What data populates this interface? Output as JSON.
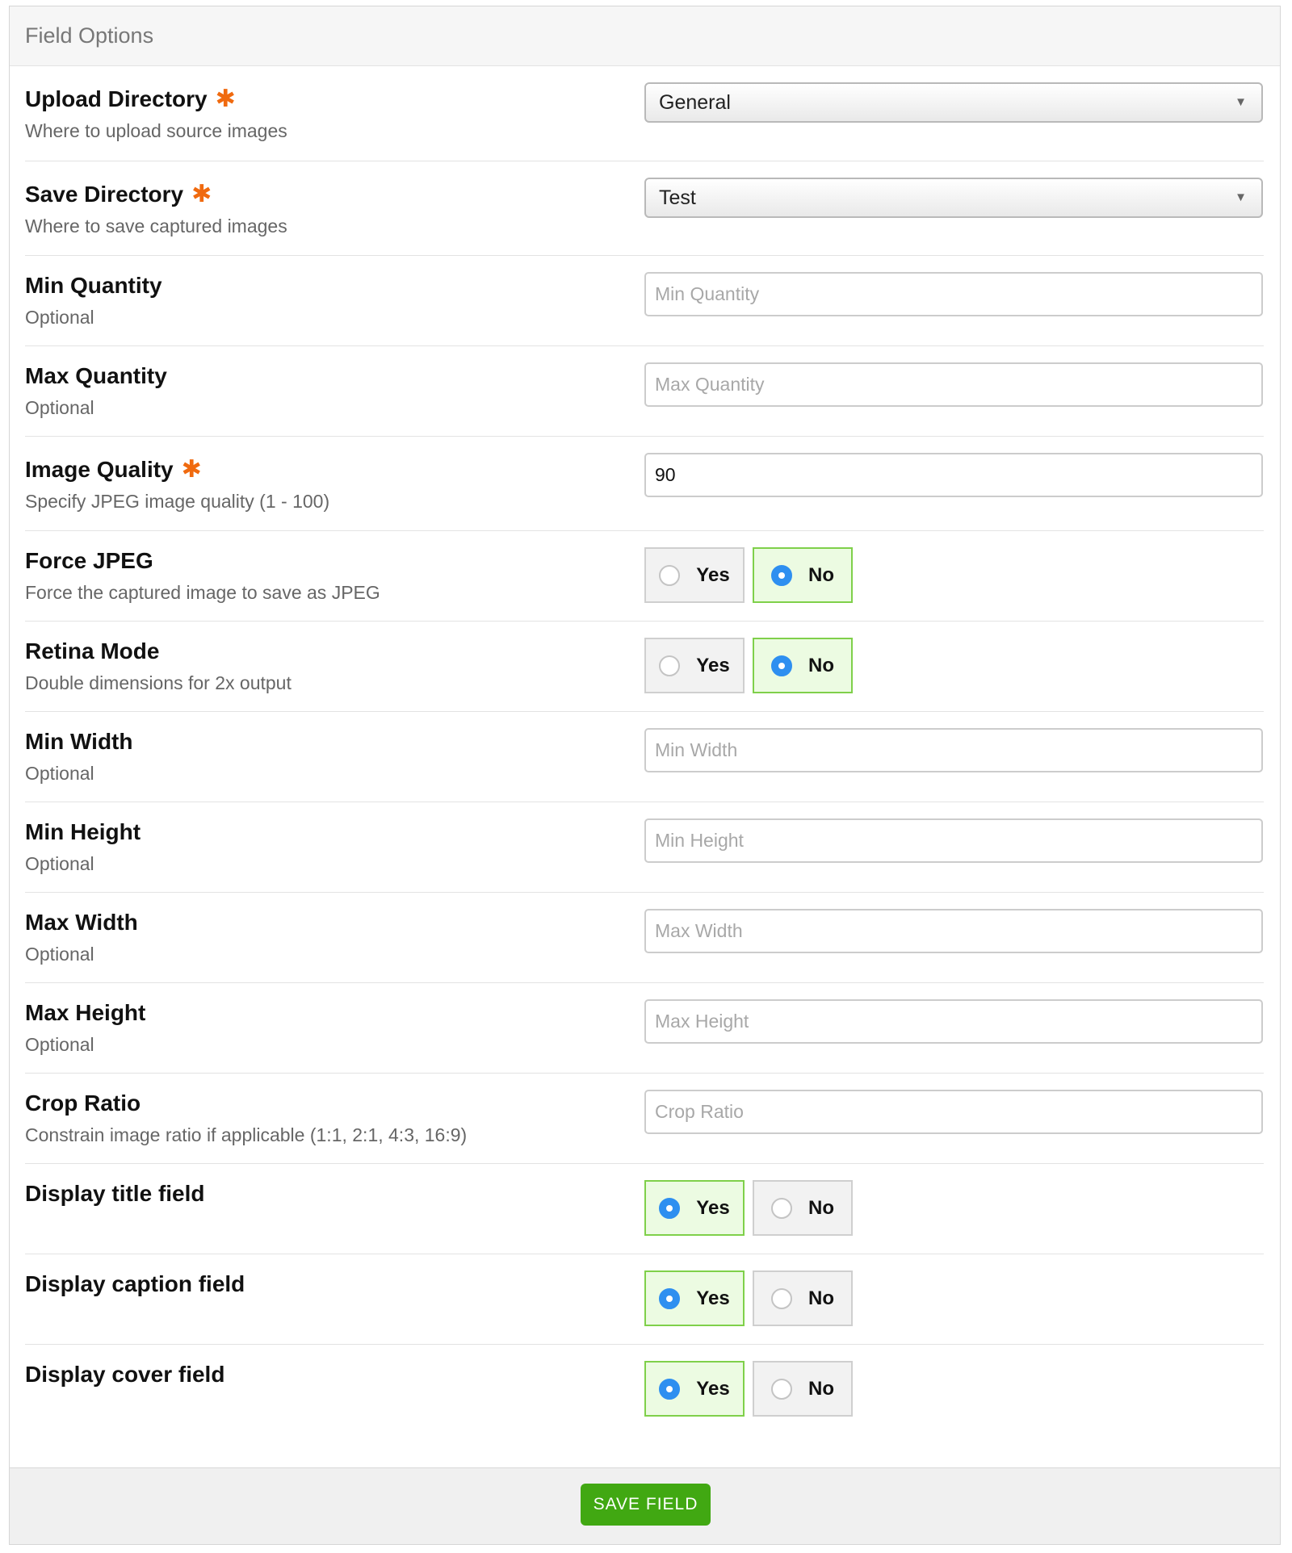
{
  "panel": {
    "title": "Field Options"
  },
  "colors": {
    "accent_green": "#41a812",
    "required_asterisk": "#f06a0f",
    "radio_selected": "#2e8ff0"
  },
  "fields": {
    "upload_directory": {
      "label": "Upload Directory",
      "required": "✱",
      "description": "Where to upload source images",
      "value": "General"
    },
    "save_directory": {
      "label": "Save Directory",
      "required": "✱",
      "description": "Where to save captured images",
      "value": "Test"
    },
    "min_quantity": {
      "label": "Min Quantity",
      "description": "Optional",
      "placeholder": "Min Quantity",
      "value": ""
    },
    "max_quantity": {
      "label": "Max Quantity",
      "description": "Optional",
      "placeholder": "Max Quantity",
      "value": ""
    },
    "image_quality": {
      "label": "Image Quality",
      "required": "✱",
      "description": "Specify JPEG image quality (1 - 100)",
      "value": "90"
    },
    "force_jpeg": {
      "label": "Force JPEG",
      "description": "Force the captured image to save as JPEG",
      "yes": "Yes",
      "no": "No",
      "selected": "no"
    },
    "retina_mode": {
      "label": "Retina Mode",
      "description": "Double dimensions for 2x output",
      "yes": "Yes",
      "no": "No",
      "selected": "no"
    },
    "min_width": {
      "label": "Min Width",
      "description": "Optional",
      "placeholder": "Min Width",
      "value": ""
    },
    "min_height": {
      "label": "Min Height",
      "description": "Optional",
      "placeholder": "Min Height",
      "value": ""
    },
    "max_width": {
      "label": "Max Width",
      "description": "Optional",
      "placeholder": "Max Width",
      "value": ""
    },
    "max_height": {
      "label": "Max Height",
      "description": "Optional",
      "placeholder": "Max Height",
      "value": ""
    },
    "crop_ratio": {
      "label": "Crop Ratio",
      "description": "Constrain image ratio if applicable (1:1, 2:1, 4:3, 16:9)",
      "placeholder": "Crop Ratio",
      "value": ""
    },
    "display_title": {
      "label": "Display title field",
      "yes": "Yes",
      "no": "No",
      "selected": "yes"
    },
    "display_caption": {
      "label": "Display caption field",
      "yes": "Yes",
      "no": "No",
      "selected": "yes"
    },
    "display_cover": {
      "label": "Display cover field",
      "yes": "Yes",
      "no": "No",
      "selected": "yes"
    }
  },
  "footer": {
    "save_label": "SAVE FIELD"
  }
}
